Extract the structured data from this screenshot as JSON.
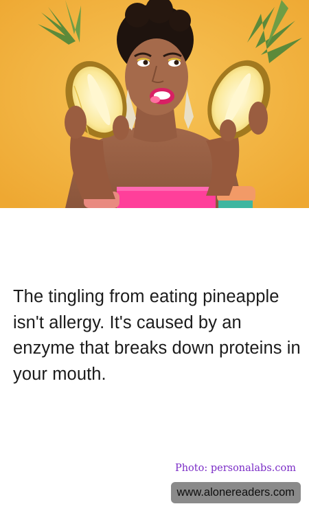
{
  "photo": {
    "subject": "woman-holding-pineapple-halves"
  },
  "caption": {
    "text": "The tingling from eating pineapple isn't allergy. It's caused by an enzyme that breaks down proteins in your mouth."
  },
  "credit": {
    "text": "Photo: personalabs.com"
  },
  "watermark": {
    "text": "www.alonereaders.com"
  },
  "colors": {
    "background": "#f3b23e",
    "credit_text": "#7a2bc6",
    "badge_bg": "#8a8a8a"
  }
}
